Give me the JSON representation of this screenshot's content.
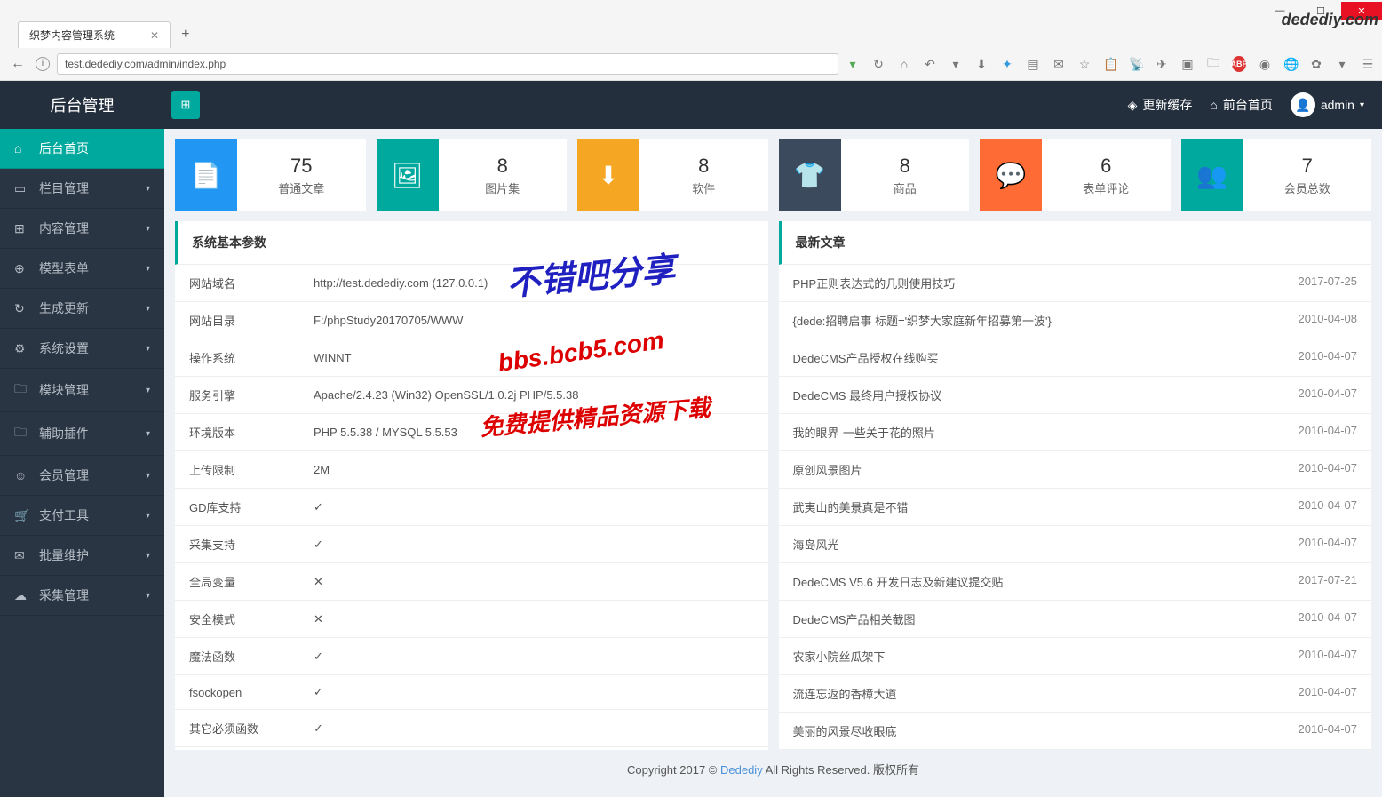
{
  "browser": {
    "tab_title": "织梦内容管理系统",
    "url": "test.dedediy.com/admin/index.php",
    "logo": "dedediy.com"
  },
  "header": {
    "title": "后台管理",
    "refresh_cache": "更新缓存",
    "frontend": "前台首页",
    "user": "admin"
  },
  "sidebar": {
    "items": [
      {
        "label": "后台首页",
        "icon": "⌂",
        "active": true,
        "chev": false
      },
      {
        "label": "栏目管理",
        "icon": "▭",
        "chev": true
      },
      {
        "label": "内容管理",
        "icon": "⊞",
        "chev": true
      },
      {
        "label": "模型表单",
        "icon": "⊕",
        "chev": true
      },
      {
        "label": "生成更新",
        "icon": "↻",
        "chev": true
      },
      {
        "label": "系统设置",
        "icon": "⚙",
        "chev": true
      },
      {
        "label": "模块管理",
        "icon": "🗀",
        "chev": true
      },
      {
        "label": "辅助插件",
        "icon": "🗀",
        "chev": true
      },
      {
        "label": "会员管理",
        "icon": "☺",
        "chev": true
      },
      {
        "label": "支付工具",
        "icon": "🛒",
        "chev": true
      },
      {
        "label": "批量维护",
        "icon": "✉",
        "chev": true
      },
      {
        "label": "采集管理",
        "icon": "☁",
        "chev": true
      }
    ]
  },
  "stats": [
    {
      "num": "75",
      "label": "普通文章",
      "icon": "📄",
      "color": "c-blue"
    },
    {
      "num": "8",
      "label": "图片集",
      "icon": "🖼",
      "color": "c-teal"
    },
    {
      "num": "8",
      "label": "软件",
      "icon": "⬇",
      "color": "c-orange"
    },
    {
      "num": "8",
      "label": "商品",
      "icon": "👕",
      "color": "c-navy"
    },
    {
      "num": "6",
      "label": "表单评论",
      "icon": "💬",
      "color": "c-orange2"
    },
    {
      "num": "7",
      "label": "会员总数",
      "icon": "👥",
      "color": "c-green"
    }
  ],
  "sys_panel": {
    "title": "系统基本参数",
    "rows": [
      {
        "k": "网站域名",
        "v": "http://test.dedediy.com (127.0.0.1)"
      },
      {
        "k": "网站目录",
        "v": "F:/phpStudy20170705/WWW"
      },
      {
        "k": "操作系统",
        "v": "WINNT"
      },
      {
        "k": "服务引擎",
        "v": "Apache/2.4.23 (Win32) OpenSSL/1.0.2j PHP/5.5.38"
      },
      {
        "k": "环境版本",
        "v": "PHP 5.5.38 / MYSQL 5.5.53"
      },
      {
        "k": "上传限制",
        "v": "2M"
      },
      {
        "k": "GD库支持",
        "v": "✓"
      },
      {
        "k": "采集支持",
        "v": "✓"
      },
      {
        "k": "全局变量",
        "v": "✕"
      },
      {
        "k": "安全模式",
        "v": "✕"
      },
      {
        "k": "魔法函数",
        "v": "✓"
      },
      {
        "k": "fsockopen",
        "v": "✓"
      },
      {
        "k": "其它必须函数",
        "v": "✓"
      }
    ]
  },
  "article_panel": {
    "title": "最新文章",
    "rows": [
      {
        "t": "PHP正则表达式的几则使用技巧",
        "d": "2017-07-25"
      },
      {
        "t": "{dede:招聘启事 标题='织梦大家庭新年招募第一波'}",
        "d": "2010-04-08"
      },
      {
        "t": "DedeCMS产品授权在线购买",
        "d": "2010-04-07"
      },
      {
        "t": "DedeCMS 最终用户授权协议",
        "d": "2010-04-07"
      },
      {
        "t": "我的眼界-一些关于花的照片",
        "d": "2010-04-07"
      },
      {
        "t": "原创风景图片",
        "d": "2010-04-07"
      },
      {
        "t": "武夷山的美景真是不错",
        "d": "2010-04-07"
      },
      {
        "t": "海岛风光",
        "d": "2010-04-07"
      },
      {
        "t": "DedeCMS V5.6 开发日志及新建议提交贴",
        "d": "2017-07-21"
      },
      {
        "t": "DedeCMS产品相关截图",
        "d": "2010-04-07"
      },
      {
        "t": "农家小院丝瓜架下",
        "d": "2010-04-07"
      },
      {
        "t": "流连忘返的香樟大道",
        "d": "2010-04-07"
      },
      {
        "t": "美丽的风景尽收眼底",
        "d": "2010-04-07"
      }
    ]
  },
  "footer": {
    "prefix": "Copyright 2017 © ",
    "link": "Dedediy",
    "suffix": " All Rights Reserved. 版权所有"
  },
  "watermark": {
    "l1": "不错吧分享",
    "l2": "bbs.bcb5.com",
    "l3": "免费提供精品资源下载"
  }
}
